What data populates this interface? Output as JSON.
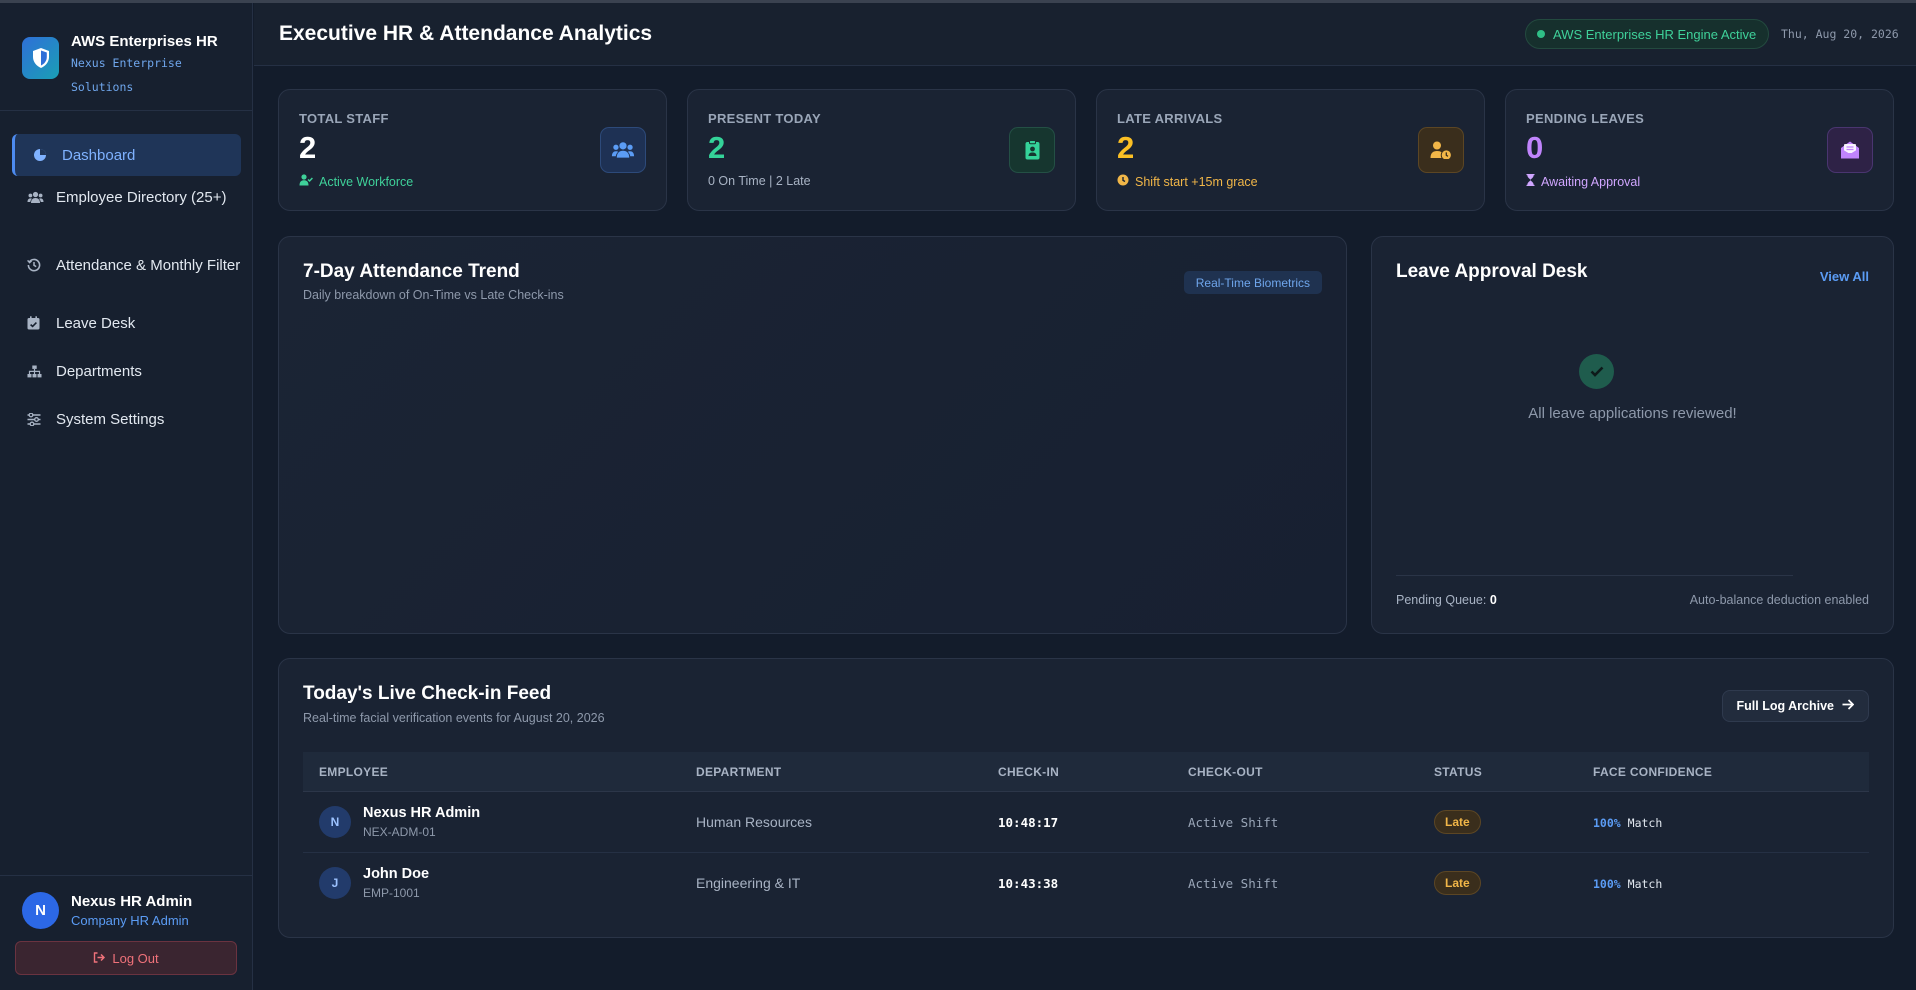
{
  "brand": {
    "title": "AWS Enterprises HR",
    "subtitle": "Nexus Enterprise Solutions",
    "accent": "#2f6fd8"
  },
  "sidebar": {
    "items": [
      {
        "label": "Dashboard",
        "icon": "pie-chart-icon",
        "active": true
      },
      {
        "label": "Employee Directory (25+)",
        "icon": "users-icon"
      },
      {
        "label": "Attendance & Monthly Filter",
        "icon": "history-icon"
      },
      {
        "label": "Leave Desk",
        "icon": "calendar-check-icon"
      },
      {
        "label": "Departments",
        "icon": "sitemap-icon"
      },
      {
        "label": "System Settings",
        "icon": "sliders-icon"
      }
    ],
    "user": {
      "initial": "N",
      "name": "Nexus HR Admin",
      "role": "Company HR Admin"
    },
    "logout_label": "Log Out"
  },
  "header": {
    "title": "Executive HR & Attendance Analytics",
    "engine_status": "AWS Enterprises HR Engine Active",
    "date": "Thu, Aug 20, 2026"
  },
  "stats": [
    {
      "label": "TOTAL STAFF",
      "value": "2",
      "note": "Active Workforce",
      "color": "#ffffff",
      "note_color": "#3fd19a",
      "icon": "users-icon"
    },
    {
      "label": "PRESENT TODAY",
      "value": "2",
      "note": "0 On Time | 2 Late",
      "color": "#34d399",
      "note_color": "#a8b3c4",
      "icon": "id-badge-icon"
    },
    {
      "label": "LATE ARRIVALS",
      "value": "2",
      "note": "Shift start +15m grace",
      "color": "#fbbf24",
      "note_color": "#f1b648",
      "icon": "user-clock-icon"
    },
    {
      "label": "PENDING LEAVES",
      "value": "0",
      "note": "Awaiting Approval",
      "color": "#c084fc",
      "note_color": "#d0a6ff",
      "icon": "envelope-open-icon"
    }
  ],
  "trend": {
    "title": "7-Day Attendance Trend",
    "subtitle": "Daily breakdown of On-Time vs Late Check-ins",
    "badge": "Real-Time Biometrics"
  },
  "leave": {
    "title": "Leave Approval Desk",
    "view_all": "View All",
    "empty_message": "All leave applications reviewed!",
    "queue_label": "Pending Queue:",
    "queue_value": "0",
    "auto_balance": "Auto-balance deduction enabled"
  },
  "feed": {
    "title": "Today's Live Check-in Feed",
    "subtitle": "Real-time facial verification events for August 20, 2026",
    "archive_label": "Full Log Archive",
    "columns": [
      "EMPLOYEE",
      "DEPARTMENT",
      "CHECK-IN",
      "CHECK-OUT",
      "STATUS",
      "FACE CONFIDENCE"
    ],
    "rows": [
      {
        "initial": "N",
        "name": "Nexus HR Admin",
        "id": "NEX-ADM-01",
        "department": "Human Resources",
        "check_in": "10:48:17",
        "check_out": "Active Shift",
        "status": "Late",
        "confidence": "100%",
        "match": "Match"
      },
      {
        "initial": "J",
        "name": "John Doe",
        "id": "EMP-1001",
        "department": "Engineering & IT",
        "check_in": "10:43:38",
        "check_out": "Active Shift",
        "status": "Late",
        "confidence": "100%",
        "match": "Match"
      }
    ]
  }
}
